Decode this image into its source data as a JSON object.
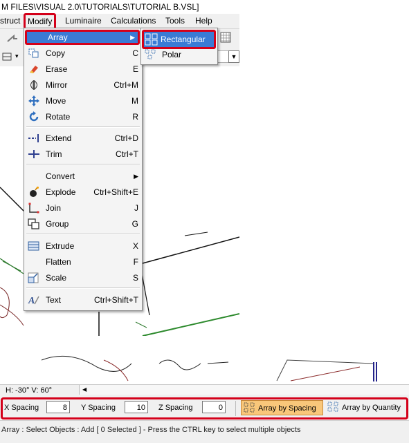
{
  "title": "M FILES\\VISUAL 2.0\\TUTORIALS\\TUTORIAL B.VSL]",
  "menubar": [
    "struct",
    "Modify",
    "Luminaire",
    "Calculations",
    "Tools",
    "Help"
  ],
  "modify_menu": {
    "array": "Array",
    "items": [
      {
        "label": "Copy",
        "shortcut": "C",
        "icon": "copy-icon"
      },
      {
        "label": "Erase",
        "shortcut": "E",
        "icon": "eraser-icon"
      },
      {
        "label": "Mirror",
        "shortcut": "Ctrl+M",
        "icon": "mirror-icon"
      },
      {
        "label": "Move",
        "shortcut": "M",
        "icon": "move-icon"
      },
      {
        "label": "Rotate",
        "shortcut": "R",
        "icon": "rotate-icon"
      },
      {
        "label": "Extend",
        "shortcut": "Ctrl+D",
        "icon": "extend-icon"
      },
      {
        "label": "Trim",
        "shortcut": "Ctrl+T",
        "icon": "trim-icon"
      },
      {
        "label": "Convert",
        "shortcut": "",
        "icon": ""
      },
      {
        "label": "Explode",
        "shortcut": "Ctrl+Shift+E",
        "icon": "bomb-icon"
      },
      {
        "label": "Join",
        "shortcut": "J",
        "icon": "join-icon"
      },
      {
        "label": "Group",
        "shortcut": "G",
        "icon": "group-icon"
      },
      {
        "label": "Extrude",
        "shortcut": "X",
        "icon": "extrude-icon"
      },
      {
        "label": "Flatten",
        "shortcut": "F",
        "icon": ""
      },
      {
        "label": "Scale",
        "shortcut": "S",
        "icon": "scale-icon"
      },
      {
        "label": "Text",
        "shortcut": "Ctrl+Shift+T",
        "icon": "text-icon"
      }
    ]
  },
  "array_submenu": {
    "rectangular": "Rectangular",
    "polar": "Polar"
  },
  "view_angle": "H: -30°  V: 60°",
  "command_bar": {
    "x_label": "X Spacing",
    "x_value": "8",
    "y_label": "Y Spacing",
    "y_value": "10",
    "z_label": "Z Spacing",
    "z_value": "0",
    "by_spacing": "Array by Spacing",
    "by_quantity": "Array by Quantity"
  },
  "status": "Array : Select Objects : Add [ 0  Selected ] - Press the CTRL key to select multiple objects",
  "colors": {
    "highlight": "#3a7bd5",
    "annotation": "#d4001a",
    "active_button": "#f9c77a"
  }
}
